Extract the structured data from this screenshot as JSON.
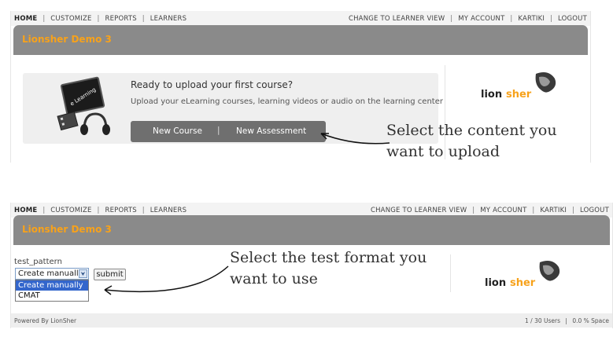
{
  "top_screen": {
    "nav": {
      "home": "HOME",
      "customize": "CUSTOMIZE",
      "reports": "REPORTS",
      "learners": "LEARNERS",
      "change_view": "CHANGE TO LEARNER VIEW",
      "my_account": "MY ACCOUNT",
      "user": "KARTIKI",
      "logout": "LOGOUT",
      "separator": "|"
    },
    "title": "Lionsher Demo 3",
    "upload": {
      "heading": "Ready to upload your first course?",
      "subtext": "Upload your eLearning courses, learning videos or audio on the learning center",
      "illustration_text": "e Learning",
      "buttons": {
        "new_course": "New Course",
        "divider": "|",
        "new_assessment": "New Assessment"
      }
    },
    "logo": {
      "part1": "lion",
      "part2": "sher"
    },
    "annotation": [
      "Select the content you",
      "want to upload"
    ]
  },
  "bottom_screen": {
    "nav": {
      "home": "HOME",
      "customize": "CUSTOMIZE",
      "reports": "REPORTS",
      "learners": "LEARNERS",
      "change_view": "CHANGE TO LEARNER VIEW",
      "my_account": "MY ACCOUNT",
      "user": "KARTIKI",
      "logout": "LOGOUT",
      "separator": "|"
    },
    "title": "Lionsher Demo 3",
    "form": {
      "label": "test_pattern",
      "selected": "Create manually",
      "arrow": "⮟",
      "options": [
        "Create manually",
        "CMAT"
      ],
      "submit": "submit"
    },
    "logo": {
      "part1": "lion",
      "part2": "sher"
    },
    "annotation": [
      "Select the test format you",
      "want to use"
    ],
    "footer": {
      "powered": "Powered By LionSher",
      "users": "1 / 30 Users",
      "separator": "|",
      "space": "0.0 % Space"
    }
  },
  "colors": {
    "accent": "#f7a21b",
    "titlebar": "#8a8a8a",
    "button_bar": "#6f6f6f",
    "select_highlight": "#3366cc"
  }
}
